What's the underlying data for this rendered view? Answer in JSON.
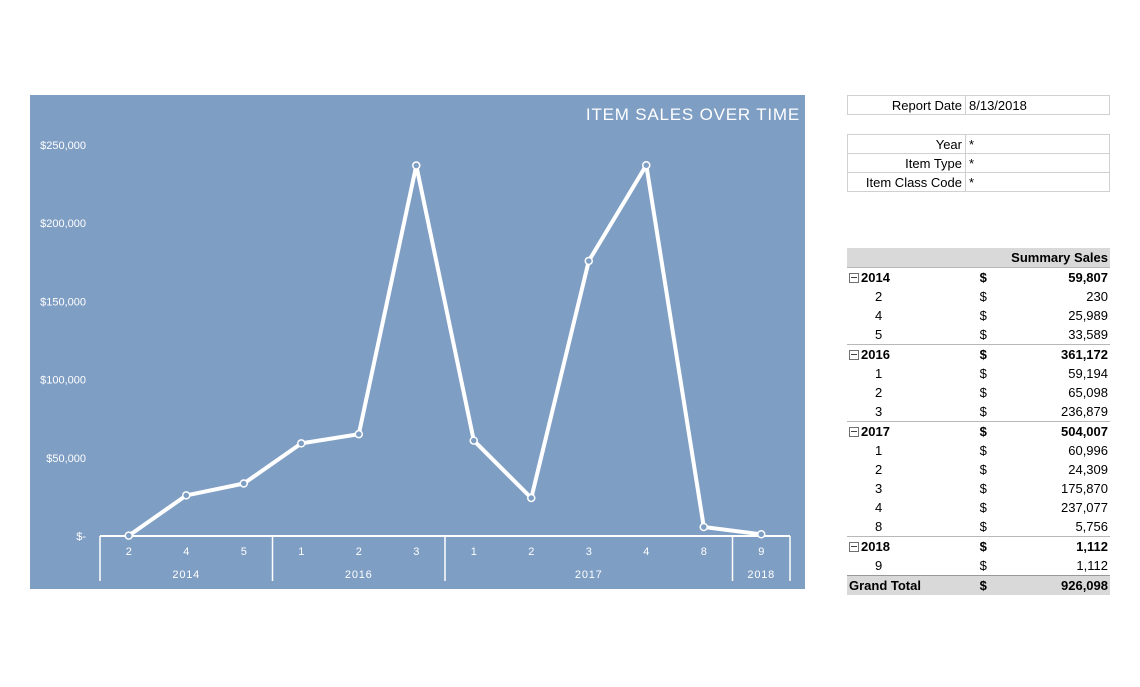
{
  "report": {
    "date_label": "Report Date",
    "date_value": "8/13/2018",
    "filters": [
      {
        "label": "Year",
        "value": "*"
      },
      {
        "label": "Item Type",
        "value": "*"
      },
      {
        "label": "Item Class Code",
        "value": "*"
      }
    ]
  },
  "summary": {
    "header": "Summary Sales",
    "years": [
      {
        "year": "2014",
        "currency": "$",
        "total": "59,807",
        "months": [
          {
            "month": "2",
            "currency": "$",
            "value": "230"
          },
          {
            "month": "4",
            "currency": "$",
            "value": "25,989"
          },
          {
            "month": "5",
            "currency": "$",
            "value": "33,589"
          }
        ]
      },
      {
        "year": "2016",
        "currency": "$",
        "total": "361,172",
        "months": [
          {
            "month": "1",
            "currency": "$",
            "value": "59,194"
          },
          {
            "month": "2",
            "currency": "$",
            "value": "65,098"
          },
          {
            "month": "3",
            "currency": "$",
            "value": "236,879"
          }
        ]
      },
      {
        "year": "2017",
        "currency": "$",
        "total": "504,007",
        "months": [
          {
            "month": "1",
            "currency": "$",
            "value": "60,996"
          },
          {
            "month": "2",
            "currency": "$",
            "value": "24,309"
          },
          {
            "month": "3",
            "currency": "$",
            "value": "175,870"
          },
          {
            "month": "4",
            "currency": "$",
            "value": "237,077"
          },
          {
            "month": "8",
            "currency": "$",
            "value": "5,756"
          }
        ]
      },
      {
        "year": "2018",
        "currency": "$",
        "total": "1,112",
        "months": [
          {
            "month": "9",
            "currency": "$",
            "value": "1,112"
          }
        ]
      }
    ],
    "grand_total_label": "Grand Total",
    "grand_total_currency": "$",
    "grand_total": "926,098"
  },
  "chart_data": {
    "type": "line",
    "title": "ITEM SALES OVER TIME",
    "background_color": "#7f9ec4",
    "line_color": "#ffffff",
    "ylim": [
      0,
      250000
    ],
    "yticks": [
      0,
      50000,
      100000,
      150000,
      200000,
      250000
    ],
    "ytick_labels": [
      "$-",
      "$50,000",
      "$100,000",
      "$150,000",
      "$200,000",
      "$250,000"
    ],
    "categories": [
      "2",
      "4",
      "5",
      "1",
      "2",
      "3",
      "1",
      "2",
      "3",
      "4",
      "8",
      "9"
    ],
    "groups": [
      {
        "label": "2014",
        "count": 3
      },
      {
        "label": "2016",
        "count": 3
      },
      {
        "label": "2017",
        "count": 5
      },
      {
        "label": "2018",
        "count": 1
      }
    ],
    "series": [
      {
        "values": [
          230,
          25989,
          33589,
          59194,
          65098,
          236879,
          60996,
          24309,
          175870,
          237077,
          5756,
          1112
        ]
      }
    ],
    "grid": false,
    "legend": "none"
  }
}
